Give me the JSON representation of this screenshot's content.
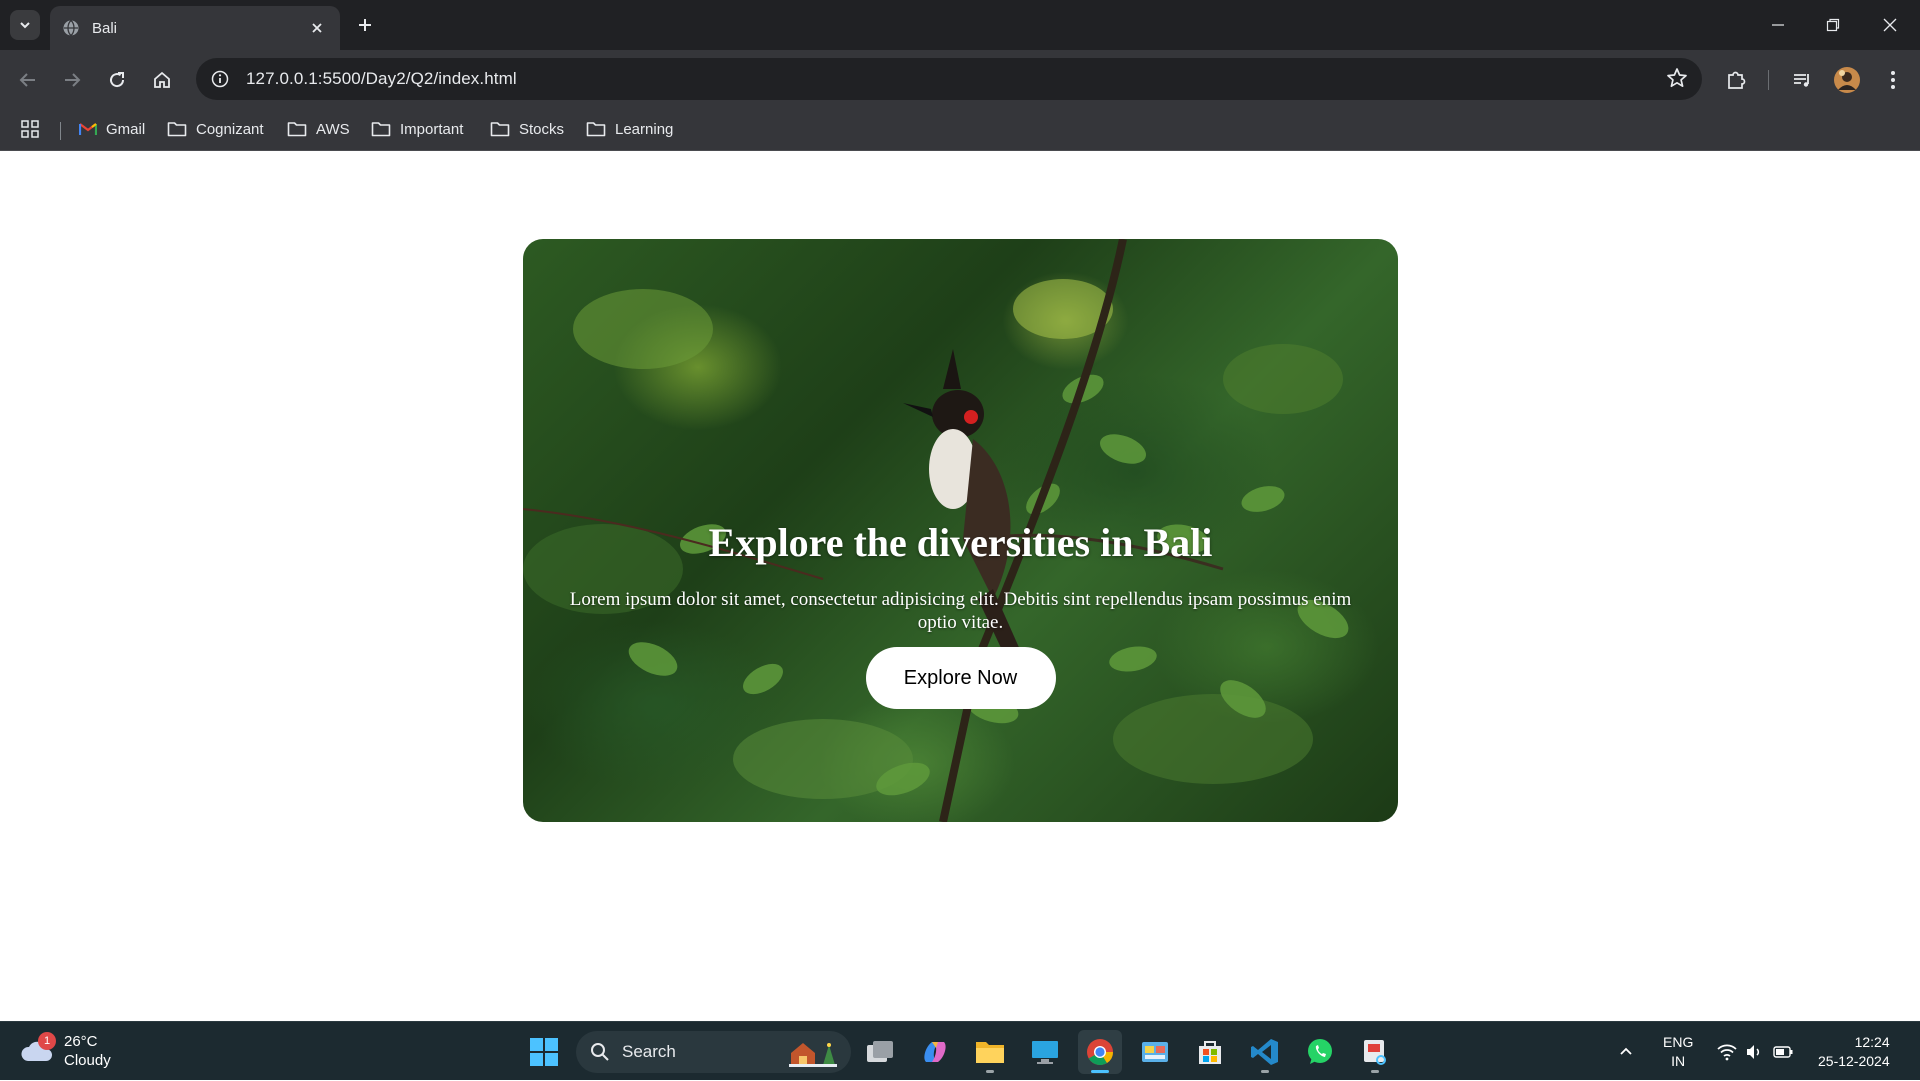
{
  "browser": {
    "tab_title": "Bali",
    "url": "127.0.0.1:5500/Day2/Q2/index.html",
    "bookmarks": [
      {
        "label": "Gmail",
        "icon": "gmail-icon"
      },
      {
        "label": "Cognizant",
        "icon": "folder-icon"
      },
      {
        "label": "AWS",
        "icon": "folder-icon"
      },
      {
        "label": "Important",
        "icon": "folder-icon"
      },
      {
        "label": "Stocks",
        "icon": "folder-icon"
      },
      {
        "label": "Learning",
        "icon": "folder-icon"
      }
    ]
  },
  "hero": {
    "title": "Explore the diversities in Bali",
    "text": "Lorem ipsum dolor sit amet, consectetur adipisicing elit. Debitis sint repellendus ipsam possimus enim optio vitae.",
    "button_label": "Explore Now"
  },
  "taskbar": {
    "weather": {
      "temp": "26°C",
      "condition": "Cloudy",
      "badge": "1"
    },
    "search_placeholder": "Search",
    "lang_primary": "ENG",
    "lang_secondary": "IN",
    "time": "12:24",
    "date": "25-12-2024"
  },
  "colors": {
    "chrome_dark": "#202124",
    "chrome_toolbar": "#35363a",
    "taskbar": "#1c2a30",
    "accent": "#4cc2ff"
  }
}
